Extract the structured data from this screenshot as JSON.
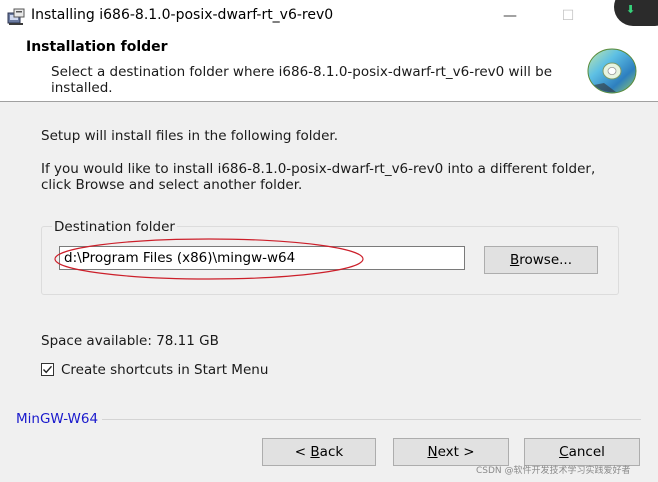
{
  "window": {
    "title": "Installing i686-8.1.0-posix-dwarf-rt_v6-rev0",
    "minimize_glyph": "—",
    "maximize_glyph": "☐",
    "download_glyph": "⬇"
  },
  "header": {
    "title": "Installation folder",
    "subtitle": "Select a destination folder where i686-8.1.0-posix-dwarf-rt_v6-rev0 will be installed."
  },
  "body": {
    "line1": "Setup will install files in the following folder.",
    "line2": "If you would like to install i686-8.1.0-posix-dwarf-rt_v6-rev0 into a different folder, click Browse and select another folder."
  },
  "destination": {
    "group_label": "Destination folder",
    "path_value": "d:\\Program Files (x86)\\mingw-w64",
    "browse_label_pre": "B",
    "browse_label_post": "rowse..."
  },
  "space_available": "Space available: 78.11 GB",
  "shortcut_checkbox": {
    "checked": true,
    "label": "Create shortcuts in Start Menu"
  },
  "brand": "MinGW-W64",
  "buttons": {
    "back_pre": "< ",
    "back_key": "B",
    "back_post": "ack",
    "next_pre": "",
    "next_key": "N",
    "next_post": "ext >",
    "cancel_pre": "",
    "cancel_key": "C",
    "cancel_post": "ancel"
  },
  "watermark": "CSDN @软件开发技术学习实践爱好者",
  "colors": {
    "annotation": "#cc1f2a",
    "brand_text": "#1a1acc",
    "download_badge": "#2b2b2b",
    "download_arrow": "#36d27a"
  },
  "icons": {
    "app": "installer-app-icon",
    "header": "cd-disc-icon",
    "checkbox": "checkmark-icon"
  }
}
